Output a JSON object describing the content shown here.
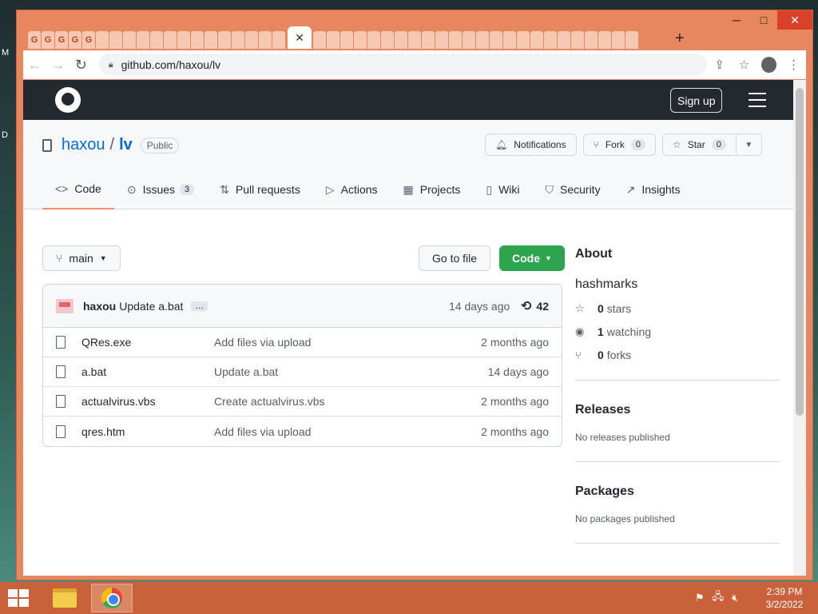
{
  "desktop": {
    "icon_label_1": "M",
    "icon_label_2": "D"
  },
  "window": {
    "minimize": "─",
    "maximize": "□",
    "close": "✕"
  },
  "tabs": {
    "active_close": "✕",
    "new_tab": "+",
    "mini_tab_glyph": "G"
  },
  "omnibox": {
    "url": "github.com/haxou/lv"
  },
  "github": {
    "sign_up": "Sign up"
  },
  "repo": {
    "owner": "haxou",
    "separator": "/",
    "name": "lv",
    "visibility": "Public",
    "notifications_label": "Notifications",
    "fork_label": "Fork",
    "fork_count": "0",
    "star_label": "Star",
    "star_count": "0"
  },
  "nav_tabs": [
    {
      "label": "Code",
      "icon": "code-icon"
    },
    {
      "label": "Issues",
      "count": "3",
      "icon": "issue-icon"
    },
    {
      "label": "Pull requests",
      "icon": "pull-request-icon"
    },
    {
      "label": "Actions",
      "icon": "play-icon"
    },
    {
      "label": "Projects",
      "icon": "table-icon"
    },
    {
      "label": "Wiki",
      "icon": "book-icon"
    },
    {
      "label": "Security",
      "icon": "shield-icon"
    },
    {
      "label": "Insights",
      "icon": "graph-icon"
    }
  ],
  "toolbar": {
    "branch": "main",
    "go_to_file": "Go to file",
    "code": "Code"
  },
  "commit": {
    "author": "haxou",
    "message": "Update a.bat",
    "ellipsis": "…",
    "time": "14 days ago",
    "count": "42"
  },
  "files": [
    {
      "name": "QRes.exe",
      "message": "Add files via upload",
      "date": "2 months ago"
    },
    {
      "name": "a.bat",
      "message": "Update a.bat",
      "date": "14 days ago"
    },
    {
      "name": "actualvirus.vbs",
      "message": "Create actualvirus.vbs",
      "date": "2 months ago"
    },
    {
      "name": "qres.htm",
      "message": "Add files via upload",
      "date": "2 months ago"
    }
  ],
  "about": {
    "heading": "About",
    "description": "hashmarks",
    "stars_count": "0",
    "stars_label": "stars",
    "watching_count": "1",
    "watching_label": "watching",
    "forks_count": "0",
    "forks_label": "forks"
  },
  "releases": {
    "heading": "Releases",
    "note": "No releases published"
  },
  "packages": {
    "heading": "Packages",
    "note": "No packages published"
  },
  "taskbar": {
    "time": "2:39 PM",
    "date": "3/2/2022"
  },
  "colors": {
    "accent_green": "#2da44e",
    "tab_underline": "#fd8c73",
    "header_dark": "#24292f",
    "window_frame": "#e7875f"
  }
}
